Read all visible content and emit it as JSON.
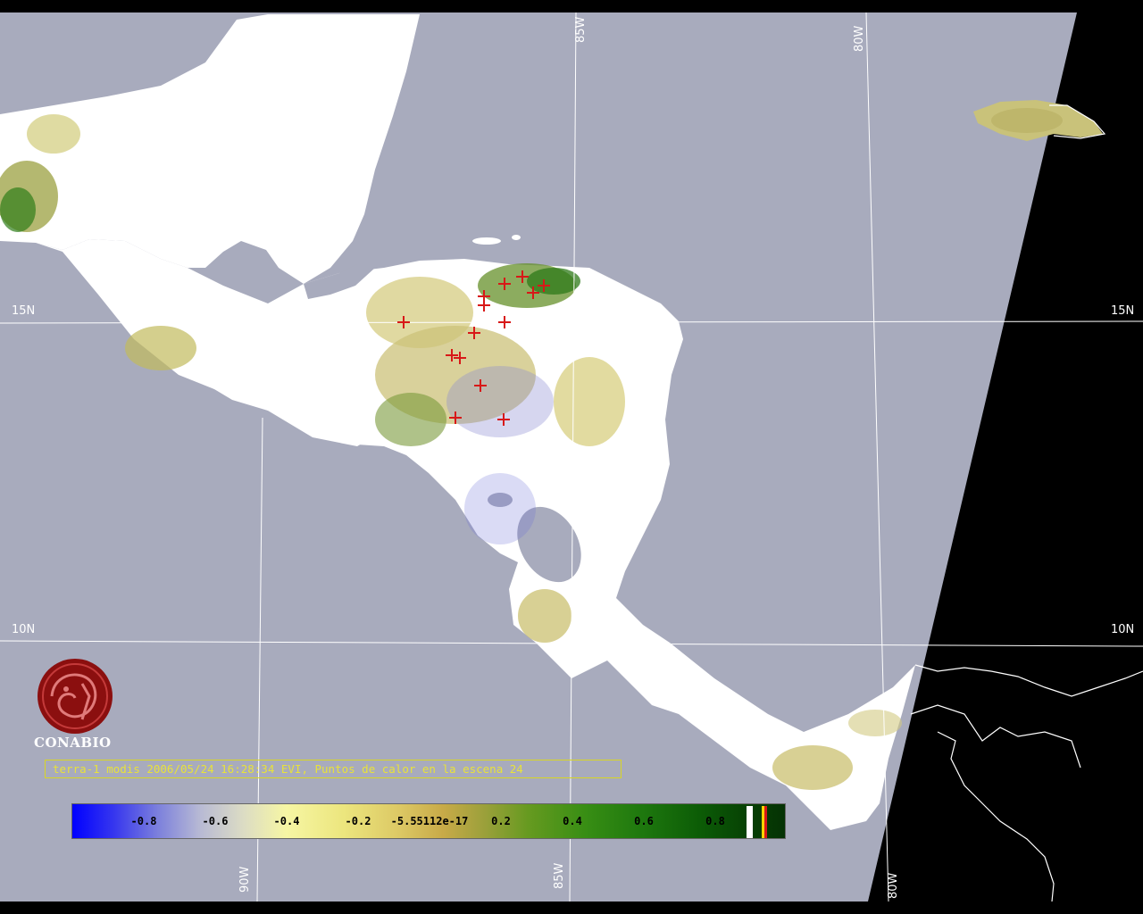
{
  "map": {
    "sea_color": "#a8abbd",
    "land_color": "#ffffff",
    "nodata_color": "#000000",
    "coast_outline_color": "#ffffff",
    "graticule_color": "#ffffff",
    "hotspot_color": "#d81818",
    "grid_labels": {
      "lat_15_left": "15N",
      "lat_15_right": "15N",
      "lat_10_left": "10N",
      "lat_10_right": "10N",
      "lon_85_top": "85W",
      "lon_80_top": "80W",
      "lon_90_bottom": "90W",
      "lon_85_bottom": "85W",
      "lon_80_bottom": "80W"
    }
  },
  "logo": {
    "icon": "conabio-logo-icon",
    "text": "CONABIO",
    "color": "#8b0f0f"
  },
  "caption": {
    "text": "terra-1 modis 2006/05/24 16:28:34 EVI, Puntos de calor en la escena 24",
    "color": "#e8e23a"
  },
  "colorbar": {
    "tick_labels": [
      "-0.8",
      "-0.6",
      "-0.4",
      "-0.2",
      "-5.55112e-17",
      "0.2",
      "0.4",
      "0.6",
      "0.8"
    ],
    "special_colors": [
      "#ffffff",
      "#ffd400",
      "#d81818"
    ]
  }
}
